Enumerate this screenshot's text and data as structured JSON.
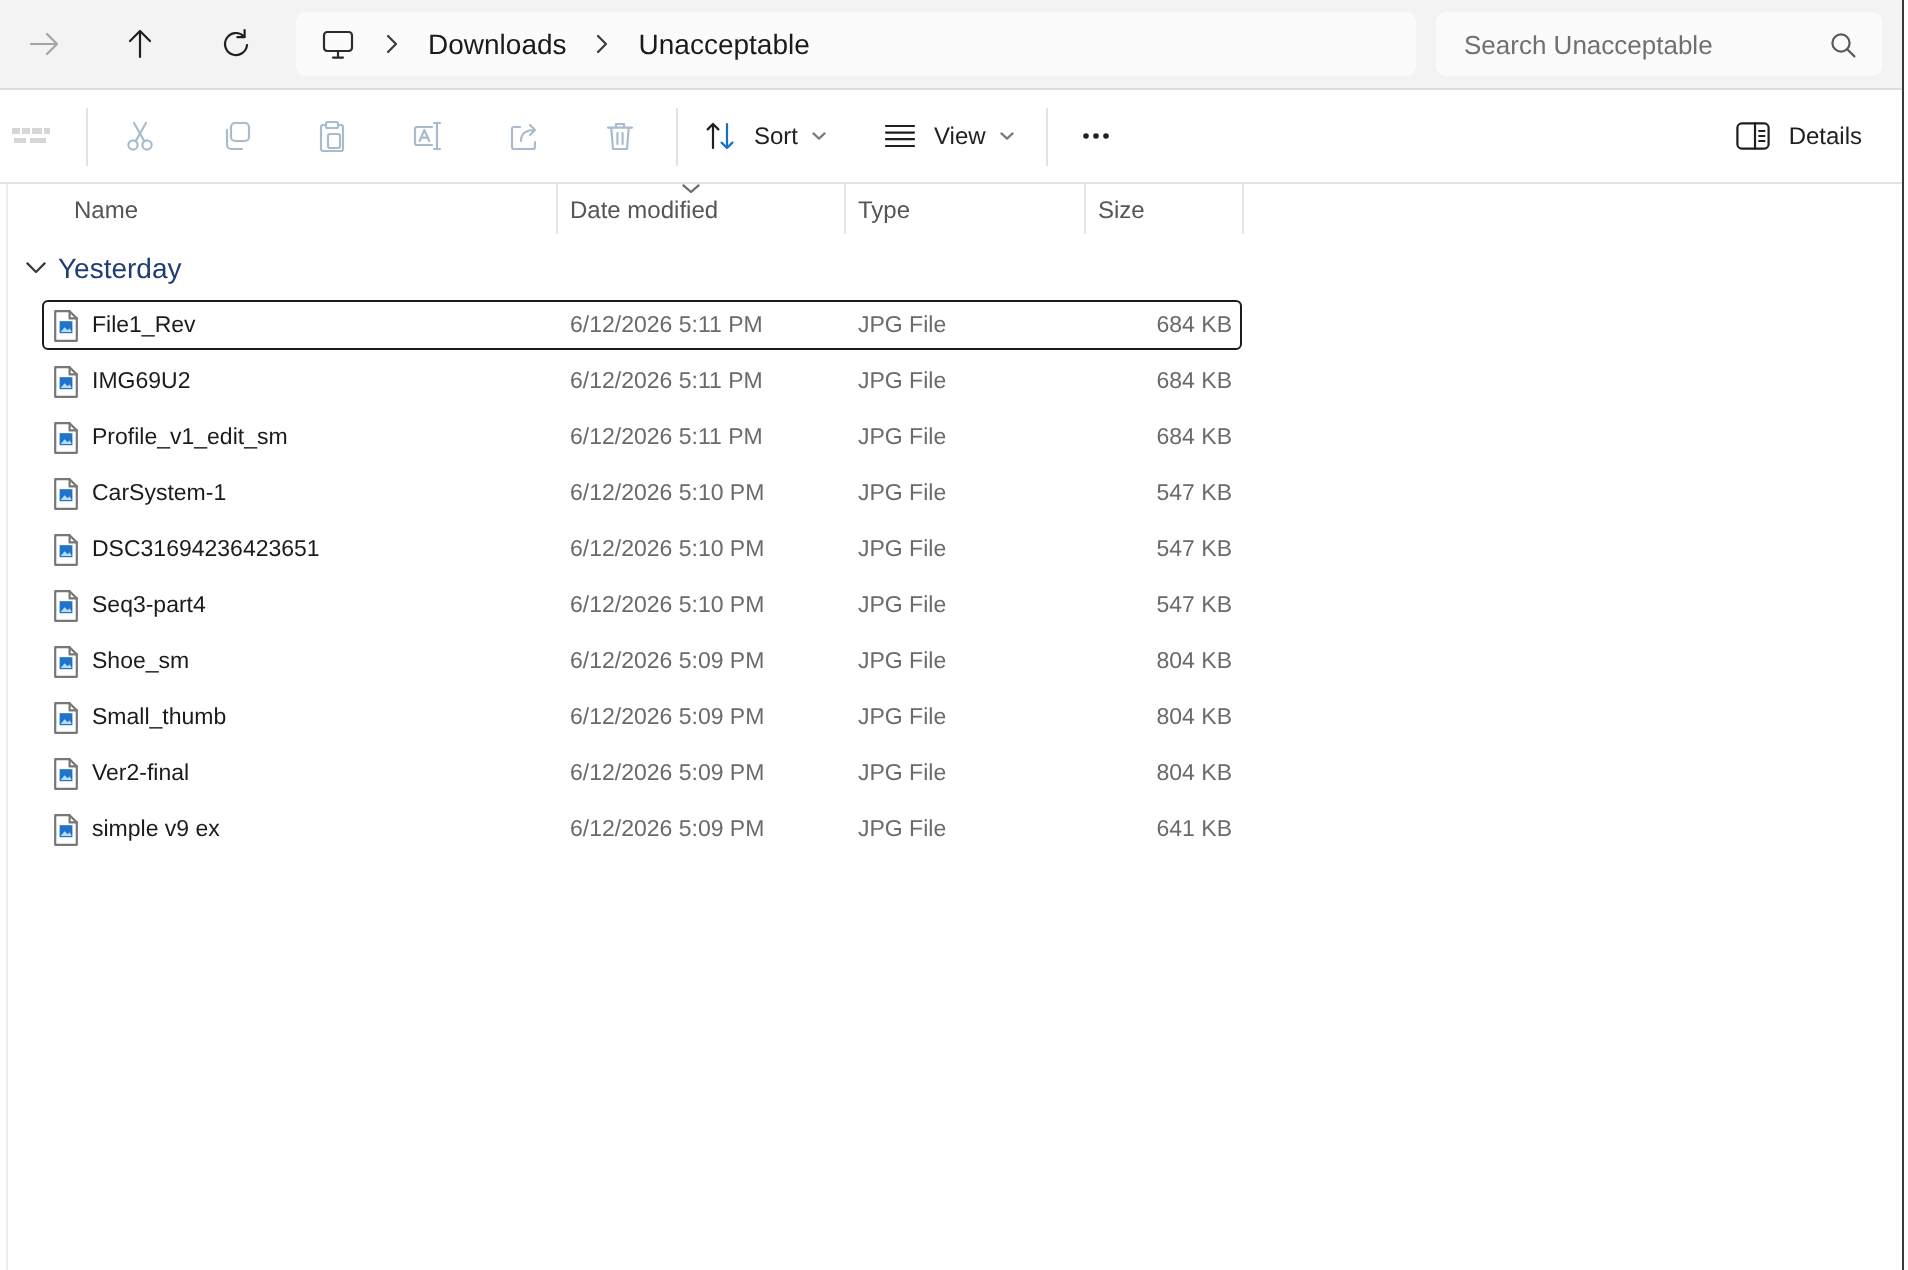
{
  "navigation": [
    {
      "kind": "forward",
      "disabled": true
    },
    {
      "kind": "up",
      "disabled": false
    },
    {
      "kind": "refresh",
      "disabled": false
    }
  ],
  "address_bar": {
    "segments": [
      "Downloads",
      "Unacceptable"
    ]
  },
  "search": {
    "placeholder": "Search Unacceptable"
  },
  "toolbar": {
    "items": [
      {
        "kind": "new",
        "disabled": true
      },
      {
        "kind": "separator"
      },
      {
        "kind": "cut",
        "disabled": true
      },
      {
        "kind": "copy",
        "disabled": true
      },
      {
        "kind": "paste",
        "disabled": true
      },
      {
        "kind": "rename",
        "disabled": true
      },
      {
        "kind": "share",
        "disabled": true
      },
      {
        "kind": "delete",
        "disabled": true
      },
      {
        "kind": "separator"
      },
      {
        "kind": "sort",
        "label": "Sort",
        "disabled": false
      },
      {
        "kind": "view",
        "label": "View",
        "disabled": false
      },
      {
        "kind": "separator"
      },
      {
        "kind": "more",
        "disabled": false
      }
    ],
    "details": {
      "label": "Details"
    }
  },
  "columns": [
    {
      "label": "Name",
      "sorted": false
    },
    {
      "label": "Date modified",
      "sorted": true
    },
    {
      "label": "Type",
      "sorted": false
    },
    {
      "label": "Size",
      "sorted": false
    }
  ],
  "groups": [
    {
      "label": "Yesterday",
      "expanded": true,
      "files": [
        {
          "name": "File1_Rev",
          "date": "6/12/2026 5:11 PM",
          "type": "JPG File",
          "size": "684 KB",
          "selected": true
        },
        {
          "name": "IMG69U2",
          "date": "6/12/2026 5:11 PM",
          "type": "JPG File",
          "size": "684 KB",
          "selected": false
        },
        {
          "name": "Profile_v1_edit_sm",
          "date": "6/12/2026 5:11 PM",
          "type": "JPG File",
          "size": "684 KB",
          "selected": false
        },
        {
          "name": "CarSystem-1",
          "date": "6/12/2026 5:10 PM",
          "type": "JPG File",
          "size": "547 KB",
          "selected": false
        },
        {
          "name": "DSC31694236423651",
          "date": "6/12/2026 5:10 PM",
          "type": "JPG File",
          "size": "547 KB",
          "selected": false
        },
        {
          "name": "Seq3-part4",
          "date": "6/12/2026 5:10 PM",
          "type": "JPG File",
          "size": "547 KB",
          "selected": false
        },
        {
          "name": "Shoe_sm",
          "date": "6/12/2026 5:09 PM",
          "type": "JPG File",
          "size": "804 KB",
          "selected": false
        },
        {
          "name": "Small_thumb",
          "date": "6/12/2026 5:09 PM",
          "type": "JPG File",
          "size": "804 KB",
          "selected": false
        },
        {
          "name": "Ver2-final",
          "date": "6/12/2026 5:09 PM",
          "type": "JPG File",
          "size": "804 KB",
          "selected": false
        },
        {
          "name": "simple v9 ex",
          "date": "6/12/2026 5:09 PM",
          "type": "JPG File",
          "size": "641 KB",
          "selected": false
        }
      ]
    }
  ]
}
